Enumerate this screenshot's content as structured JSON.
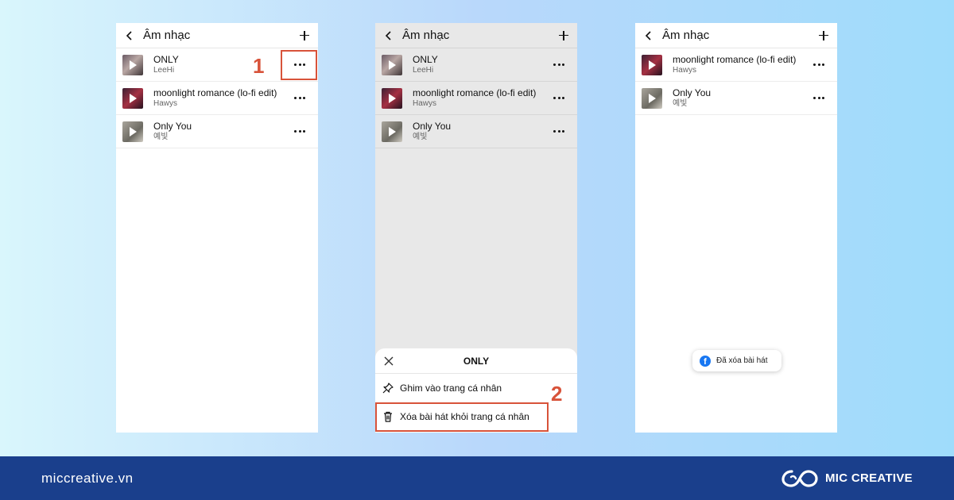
{
  "screens": [
    {
      "header": {
        "title": "Âm nhạc"
      },
      "songs": [
        {
          "title": "ONLY",
          "artist": "LeeHi"
        },
        {
          "title": "moonlight romance (lo-fi edit)",
          "artist": "Hawys"
        },
        {
          "title": "Only You",
          "artist": "예빛"
        }
      ]
    },
    {
      "header": {
        "title": "Âm nhạc"
      },
      "songs": [
        {
          "title": "ONLY",
          "artist": "LeeHi"
        },
        {
          "title": "moonlight romance (lo-fi edit)",
          "artist": "Hawys"
        },
        {
          "title": "Only You",
          "artist": "예빛"
        }
      ],
      "sheet": {
        "title": "ONLY",
        "options": [
          {
            "label": "Ghim vào trang cá nhân",
            "icon": "pin-icon"
          },
          {
            "label": "Xóa bài hát khỏi trang cá nhân",
            "icon": "trash-icon"
          }
        ]
      }
    },
    {
      "header": {
        "title": "Âm nhạc"
      },
      "songs": [
        {
          "title": "moonlight romance (lo-fi edit)",
          "artist": "Hawys"
        },
        {
          "title": "Only You",
          "artist": "예빛"
        }
      ],
      "toast": {
        "text": "Đã xóa bài hát",
        "icon": "facebook-icon"
      }
    }
  ],
  "steps": [
    "1",
    "2"
  ],
  "footer": {
    "site": "miccreative.vn",
    "brand": "MIC CREATIVE"
  },
  "colors": {
    "highlight": "#d8533a",
    "footer_bg": "#1a3f8c",
    "facebook": "#1877f2"
  }
}
